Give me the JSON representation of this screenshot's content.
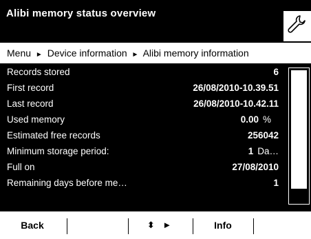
{
  "header": {
    "title": "Alibi memory status overview"
  },
  "breadcrumb": {
    "items": [
      "Menu",
      "Device information",
      "Alibi memory information"
    ],
    "separator": "►"
  },
  "rows": [
    {
      "label": "Records stored",
      "value": "6",
      "unit": ""
    },
    {
      "label": "First record",
      "value": "26/08/2010-10.39.51",
      "unit": ""
    },
    {
      "label": "Last record",
      "value": "26/08/2010-10.42.11",
      "unit": ""
    },
    {
      "label": "Used memory",
      "value": "0.00",
      "unit": "%"
    },
    {
      "label": "Estimated free records",
      "value": "256042",
      "unit": ""
    },
    {
      "label": "Minimum storage period:",
      "value": "1",
      "unit": "Da…"
    },
    {
      "label": "Full on",
      "value": "27/08/2010",
      "unit": ""
    },
    {
      "label": "Remaining days before me…",
      "value": "1",
      "unit": ""
    }
  ],
  "softkeys": {
    "back_label": "Back",
    "nav_label": "⬍ ►",
    "info_label": "Info"
  },
  "icons": {
    "settings": "wrench-icon"
  },
  "colors": {
    "background": "#000000",
    "foreground": "#ffffff"
  }
}
